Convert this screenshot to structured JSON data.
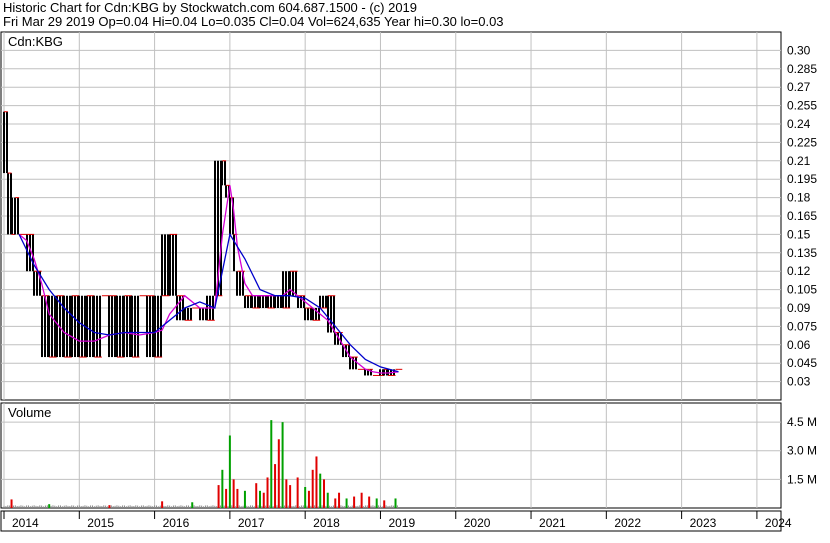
{
  "header": {
    "line1": "Historic Chart for Cdn:KBG by Stockwatch.com 604.687.1500 - (c) 2019",
    "line2": "Fri Mar 29 2019   Op=0.04   Hi=0.04   Lo=0.035   Cl=0.04   Vol=624,635   Year hi=0.30   lo=0.03"
  },
  "colors": {
    "grid": "#c0c0c0",
    "price_bar": "#000000",
    "ma_short": "#d400d4",
    "ma_long": "#0000cc",
    "vol_up": "#00a000",
    "vol_down": "#e00000",
    "vol_flat": "#888888"
  },
  "chart_data": [
    {
      "type": "line",
      "panel": "price",
      "symbol_label": "Cdn:KBG",
      "ylim": [
        0.015,
        0.315
      ],
      "yticks": [
        0.3,
        0.285,
        0.27,
        0.255,
        0.24,
        0.225,
        0.21,
        0.195,
        0.18,
        0.165,
        0.15,
        0.135,
        0.12,
        0.105,
        0.09,
        0.075,
        0.06,
        0.045,
        0.03
      ],
      "ytick_labels": [
        "0.30",
        "0.285",
        "0.27",
        "0.255",
        "0.24",
        "0.225",
        "0.21",
        "0.195",
        "0.18",
        "0.165",
        "0.15",
        "0.135",
        "0.12",
        "0.105",
        "0.09",
        "0.075",
        "0.06",
        "0.045",
        "0.03"
      ],
      "grid": true,
      "series": [
        {
          "role": "price",
          "x": [
            2014.0,
            2014.05,
            2014.1,
            2014.15,
            2014.2,
            2014.3,
            2014.4,
            2014.5,
            2014.6,
            2014.7,
            2014.8,
            2014.9,
            2015.0,
            2015.1,
            2015.2,
            2015.3,
            2015.4,
            2015.5,
            2015.6,
            2015.7,
            2015.8,
            2015.9,
            2016.0,
            2016.1,
            2016.2,
            2016.3,
            2016.4,
            2016.5,
            2016.6,
            2016.7,
            2016.8,
            2016.9,
            2016.95,
            2017.0,
            2017.05,
            2017.1,
            2017.2,
            2017.3,
            2017.4,
            2017.5,
            2017.6,
            2017.7,
            2017.8,
            2017.9,
            2018.0,
            2018.1,
            2018.2,
            2018.3,
            2018.4,
            2018.5,
            2018.6,
            2018.7,
            2018.8,
            2018.9,
            2019.0,
            2019.05,
            2019.1,
            2019.2,
            2019.24
          ],
          "values": [
            0.25,
            0.2,
            0.15,
            0.18,
            0.15,
            0.15,
            0.12,
            0.1,
            0.05,
            0.1,
            0.05,
            0.1,
            0.05,
            0.1,
            0.05,
            0.1,
            0.1,
            0.05,
            0.1,
            0.05,
            0.1,
            0.1,
            0.05,
            0.1,
            0.15,
            0.1,
            0.08,
            0.09,
            0.09,
            0.08,
            0.1,
            0.21,
            0.19,
            0.18,
            0.15,
            0.12,
            0.1,
            0.09,
            0.1,
            0.09,
            0.1,
            0.09,
            0.12,
            0.1,
            0.09,
            0.08,
            0.09,
            0.1,
            0.07,
            0.06,
            0.05,
            0.04,
            0.04,
            0.035,
            0.035,
            0.04,
            0.035,
            0.04,
            0.04
          ]
        },
        {
          "role": "ma_short",
          "x": [
            2014.2,
            2014.3,
            2014.4,
            2014.5,
            2014.6,
            2014.8,
            2015.0,
            2015.2,
            2015.4,
            2015.6,
            2015.8,
            2016.0,
            2016.1,
            2016.2,
            2016.4,
            2016.6,
            2016.8,
            2016.9,
            2017.0,
            2017.05,
            2017.1,
            2017.2,
            2017.3,
            2017.5,
            2017.7,
            2017.8,
            2017.9,
            2018.0,
            2018.1,
            2018.2,
            2018.3,
            2018.4,
            2018.5,
            2018.6,
            2018.7,
            2018.8,
            2018.9,
            2019.0,
            2019.1,
            2019.24
          ],
          "values": [
            0.15,
            0.145,
            0.13,
            0.11,
            0.085,
            0.07,
            0.063,
            0.063,
            0.068,
            0.07,
            0.068,
            0.07,
            0.072,
            0.085,
            0.1,
            0.09,
            0.09,
            0.15,
            0.19,
            0.17,
            0.14,
            0.11,
            0.1,
            0.1,
            0.1,
            0.105,
            0.1,
            0.095,
            0.09,
            0.085,
            0.08,
            0.07,
            0.06,
            0.05,
            0.045,
            0.04,
            0.038,
            0.037,
            0.037,
            0.038
          ]
        },
        {
          "role": "ma_long",
          "x": [
            2014.2,
            2014.4,
            2014.6,
            2014.8,
            2015.0,
            2015.2,
            2015.4,
            2015.6,
            2015.8,
            2016.0,
            2016.2,
            2016.4,
            2016.6,
            2016.8,
            2016.9,
            2017.0,
            2017.1,
            2017.2,
            2017.4,
            2017.6,
            2017.8,
            2018.0,
            2018.2,
            2018.4,
            2018.6,
            2018.8,
            2019.0,
            2019.24
          ],
          "values": [
            0.15,
            0.125,
            0.105,
            0.09,
            0.078,
            0.07,
            0.068,
            0.07,
            0.07,
            0.07,
            0.08,
            0.09,
            0.095,
            0.09,
            0.12,
            0.15,
            0.14,
            0.13,
            0.105,
            0.1,
            0.1,
            0.098,
            0.09,
            0.075,
            0.06,
            0.048,
            0.042,
            0.038
          ]
        }
      ]
    },
    {
      "type": "bar",
      "panel": "volume",
      "title": "Volume",
      "ylim": [
        0,
        5.5
      ],
      "yticks": [
        1.5,
        3.0,
        4.5
      ],
      "ytick_labels": [
        "1.5 M",
        "3.0 M",
        "4.5 M"
      ],
      "grid": true,
      "spikes": [
        {
          "x": 2014.1,
          "value": 0.45,
          "dir": "down"
        },
        {
          "x": 2014.6,
          "value": 0.2,
          "dir": "up"
        },
        {
          "x": 2015.4,
          "value": 0.15,
          "dir": "down"
        },
        {
          "x": 2016.1,
          "value": 0.35,
          "dir": "down"
        },
        {
          "x": 2016.5,
          "value": 0.3,
          "dir": "up"
        },
        {
          "x": 2016.85,
          "value": 1.2,
          "dir": "down"
        },
        {
          "x": 2016.9,
          "value": 2.0,
          "dir": "up"
        },
        {
          "x": 2016.95,
          "value": 1.0,
          "dir": "down"
        },
        {
          "x": 2017.0,
          "value": 3.8,
          "dir": "up"
        },
        {
          "x": 2017.05,
          "value": 1.5,
          "dir": "down"
        },
        {
          "x": 2017.1,
          "value": 1.0,
          "dir": "down"
        },
        {
          "x": 2017.2,
          "value": 0.9,
          "dir": "up"
        },
        {
          "x": 2017.35,
          "value": 1.3,
          "dir": "down"
        },
        {
          "x": 2017.4,
          "value": 0.9,
          "dir": "up"
        },
        {
          "x": 2017.45,
          "value": 0.8,
          "dir": "down"
        },
        {
          "x": 2017.5,
          "value": 1.6,
          "dir": "down"
        },
        {
          "x": 2017.55,
          "value": 4.6,
          "dir": "up"
        },
        {
          "x": 2017.6,
          "value": 2.3,
          "dir": "down"
        },
        {
          "x": 2017.65,
          "value": 3.6,
          "dir": "down"
        },
        {
          "x": 2017.7,
          "value": 4.5,
          "dir": "up"
        },
        {
          "x": 2017.75,
          "value": 1.5,
          "dir": "down"
        },
        {
          "x": 2017.8,
          "value": 1.2,
          "dir": "down"
        },
        {
          "x": 2017.9,
          "value": 1.6,
          "dir": "down"
        },
        {
          "x": 2018.0,
          "value": 1.1,
          "dir": "up"
        },
        {
          "x": 2018.05,
          "value": 0.9,
          "dir": "down"
        },
        {
          "x": 2018.1,
          "value": 2.0,
          "dir": "down"
        },
        {
          "x": 2018.15,
          "value": 2.7,
          "dir": "down"
        },
        {
          "x": 2018.2,
          "value": 1.8,
          "dir": "up"
        },
        {
          "x": 2018.25,
          "value": 1.5,
          "dir": "down"
        },
        {
          "x": 2018.3,
          "value": 0.8,
          "dir": "up"
        },
        {
          "x": 2018.4,
          "value": 0.5,
          "dir": "down"
        },
        {
          "x": 2018.45,
          "value": 0.8,
          "dir": "down"
        },
        {
          "x": 2018.55,
          "value": 0.5,
          "dir": "up"
        },
        {
          "x": 2018.65,
          "value": 0.6,
          "dir": "down"
        },
        {
          "x": 2018.75,
          "value": 0.8,
          "dir": "down"
        },
        {
          "x": 2018.85,
          "value": 0.6,
          "dir": "down"
        },
        {
          "x": 2018.95,
          "value": 0.5,
          "dir": "up"
        },
        {
          "x": 2019.05,
          "value": 0.4,
          "dir": "down"
        },
        {
          "x": 2019.2,
          "value": 0.5,
          "dir": "up"
        }
      ]
    },
    {
      "type": "axis",
      "panel": "time",
      "xlim": [
        2013.96,
        2024.32
      ],
      "categories": [
        "2014",
        "2015",
        "2016",
        "2017",
        "2018",
        "2019",
        "2020",
        "2021",
        "2022",
        "2023",
        "2024"
      ]
    }
  ]
}
